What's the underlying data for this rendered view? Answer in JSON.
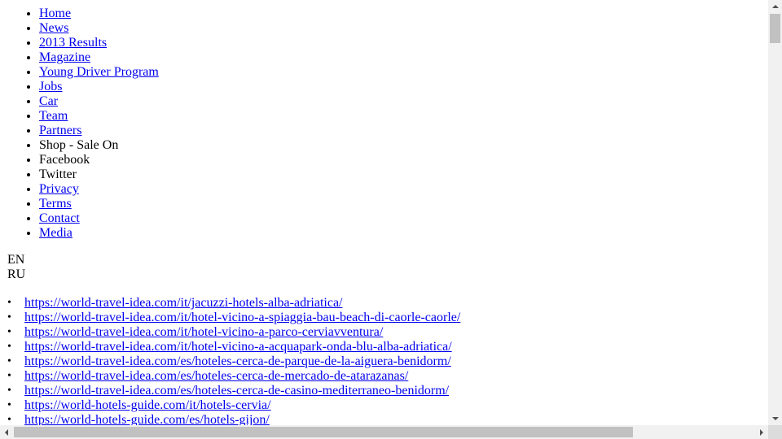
{
  "nav": {
    "items": [
      {
        "label": "Home",
        "link": true
      },
      {
        "label": "News",
        "link": true
      },
      {
        "label": "2013 Results",
        "link": true
      },
      {
        "label": "Magazine",
        "link": true
      },
      {
        "label": "Young Driver Program",
        "link": true
      },
      {
        "label": "Jobs",
        "link": true
      },
      {
        "label": "Car",
        "link": true
      },
      {
        "label": "Team",
        "link": true
      },
      {
        "label": "Partners",
        "link": true
      },
      {
        "label": "Shop - Sale On",
        "link": false
      },
      {
        "label": "Facebook",
        "link": false
      },
      {
        "label": "Twitter",
        "link": false
      },
      {
        "label": "Privacy",
        "link": true
      },
      {
        "label": "Terms",
        "link": true
      },
      {
        "label": "Contact",
        "link": true
      },
      {
        "label": "Media",
        "link": true
      }
    ]
  },
  "languages": [
    "EN",
    "RU"
  ],
  "links": {
    "bullet": "•",
    "items": [
      "https://world-travel-idea.com/it/jacuzzi-hotels-alba-adriatica/",
      "https://world-travel-idea.com/it/hotel-vicino-a-spiaggia-bau-beach-di-caorle-caorle/",
      "https://world-travel-idea.com/it/hotel-vicino-a-parco-cerviavventura/",
      "https://world-travel-idea.com/it/hotel-vicino-a-acquapark-onda-blu-alba-adriatica/",
      "https://world-travel-idea.com/es/hoteles-cerca-de-parque-de-la-aiguera-benidorm/",
      "https://world-travel-idea.com/es/hoteles-cerca-de-mercado-de-atarazanas/",
      "https://world-travel-idea.com/es/hoteles-cerca-de-casino-mediterraneo-benidorm/",
      "https://world-hotels-guide.com/it/hotels-cervia/",
      "https://world-hotels-guide.com/es/hotels-gijon/"
    ]
  },
  "colors": {
    "link": "#0000ee",
    "text": "#000000",
    "background": "#ffffff",
    "scrollbar_track": "#f1f1f1",
    "scrollbar_thumb": "#c1c1c1"
  },
  "scroll": {
    "vertical_position": 0.0,
    "horizontal_position": 0.0
  }
}
